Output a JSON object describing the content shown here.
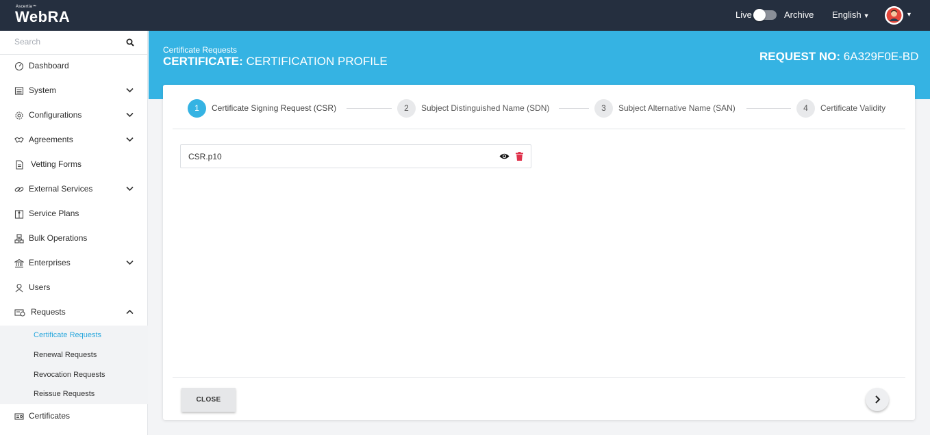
{
  "app": {
    "brand_small": "Ascertia™",
    "name": "WebRA"
  },
  "topbar": {
    "live_label": "Live",
    "archive_label": "Archive",
    "language": "English"
  },
  "sidebar": {
    "search_placeholder": "Search",
    "items": [
      {
        "label": "Dashboard",
        "icon": "dashboard-icon"
      },
      {
        "label": "System",
        "icon": "system-icon"
      },
      {
        "label": "Configurations",
        "icon": "gear-icon"
      },
      {
        "label": "Agreements",
        "icon": "handshake-icon"
      },
      {
        "label": "Vetting Forms",
        "icon": "form-icon"
      },
      {
        "label": "External Services",
        "icon": "link-icon"
      },
      {
        "label": "Service Plans",
        "icon": "service-plans-icon"
      },
      {
        "label": "Bulk Operations",
        "icon": "bulk-icon"
      },
      {
        "label": "Enterprises",
        "icon": "bank-icon"
      },
      {
        "label": "Users",
        "icon": "user-icon"
      },
      {
        "label": "Requests",
        "icon": "requests-icon"
      },
      {
        "label": "Certificates",
        "icon": "certificate-icon"
      }
    ],
    "sub_items": [
      {
        "label": "Certificate Requests",
        "active": true
      },
      {
        "label": "Renewal Requests"
      },
      {
        "label": "Revocation Requests"
      },
      {
        "label": "Reissue Requests"
      }
    ]
  },
  "header": {
    "breadcrumb": "Certificate Requests",
    "title_bold": "CERTIFICATE:",
    "title_rest": " CERTIFICATION PROFILE",
    "request_label": "REQUEST NO:",
    "request_no": " 6A329F0E-BD"
  },
  "wizard": {
    "steps": [
      {
        "num": "1",
        "label": "Certificate Signing Request (CSR)",
        "active": true
      },
      {
        "num": "2",
        "label": "Subject Distinguished Name (SDN)"
      },
      {
        "num": "3",
        "label": "Subject Alternative Name (SAN)"
      },
      {
        "num": "4",
        "label": "Certificate Validity"
      }
    ],
    "file_name": "CSR.p10",
    "close_label": "CLOSE"
  },
  "colors": {
    "topbar": "#252f3f",
    "accent": "#35b3e3",
    "delete": "#e0334c"
  }
}
